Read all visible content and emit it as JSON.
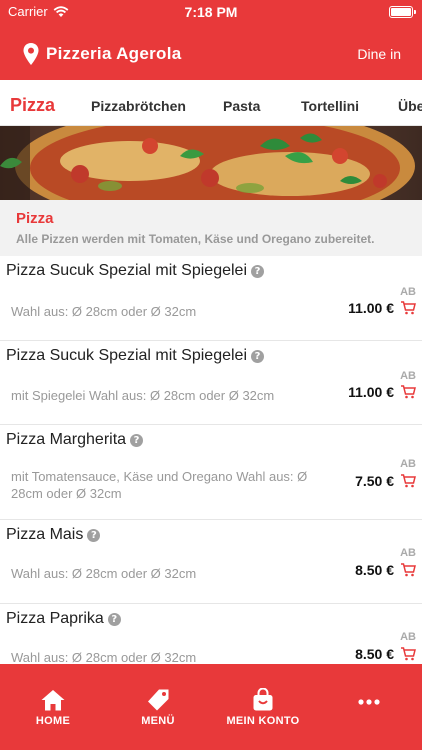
{
  "status_bar": {
    "carrier": "Carrier",
    "time": "7:18 PM"
  },
  "header": {
    "title": "Pizzeria Agerola",
    "mode": "Dine in"
  },
  "tabs": [
    {
      "label": "Pizza",
      "active": true
    },
    {
      "label": "Pizzabrötchen"
    },
    {
      "label": "Pasta"
    },
    {
      "label": "Tortellini"
    },
    {
      "label": "Übe"
    }
  ],
  "category": {
    "title": "Pizza",
    "description": "Alle Pizzen werden mit Tomaten, Käse und Oregano zubereitet."
  },
  "products": [
    {
      "name": "Pizza Sucuk Spezial mit Spiegelei",
      "description": "Wahl aus: Ø 28cm oder Ø 32cm",
      "ab": "AB",
      "price": "11.00 €"
    },
    {
      "name": "Pizza Sucuk Spezial mit Spiegelei",
      "description": "mit Spiegelei Wahl aus: Ø 28cm oder Ø 32cm",
      "ab": "AB",
      "price": "11.00 €"
    },
    {
      "name": "Pizza Margherita",
      "description": "mit Tomatensauce, Käse und Oregano Wahl aus: Ø 28cm oder Ø 32cm",
      "ab": "AB",
      "price": "7.50 €"
    },
    {
      "name": "Pizza Mais",
      "description": "Wahl aus: Ø 28cm oder Ø 32cm",
      "ab": "AB",
      "price": "8.50 €"
    },
    {
      "name": "Pizza Paprika",
      "description": "Wahl aus: Ø 28cm oder Ø 32cm",
      "ab": "AB",
      "price": "8.50 €"
    }
  ],
  "bottom_nav": [
    {
      "label": "HOME",
      "icon": "home-icon"
    },
    {
      "label": "MENÜ",
      "icon": "tag-icon"
    },
    {
      "label": "MEIN KONTO",
      "icon": "bag-icon"
    },
    {
      "label": "",
      "icon": "more-icon"
    }
  ],
  "colors": {
    "brand": "#e8393a",
    "price": "#111111",
    "muted": "#999999"
  }
}
